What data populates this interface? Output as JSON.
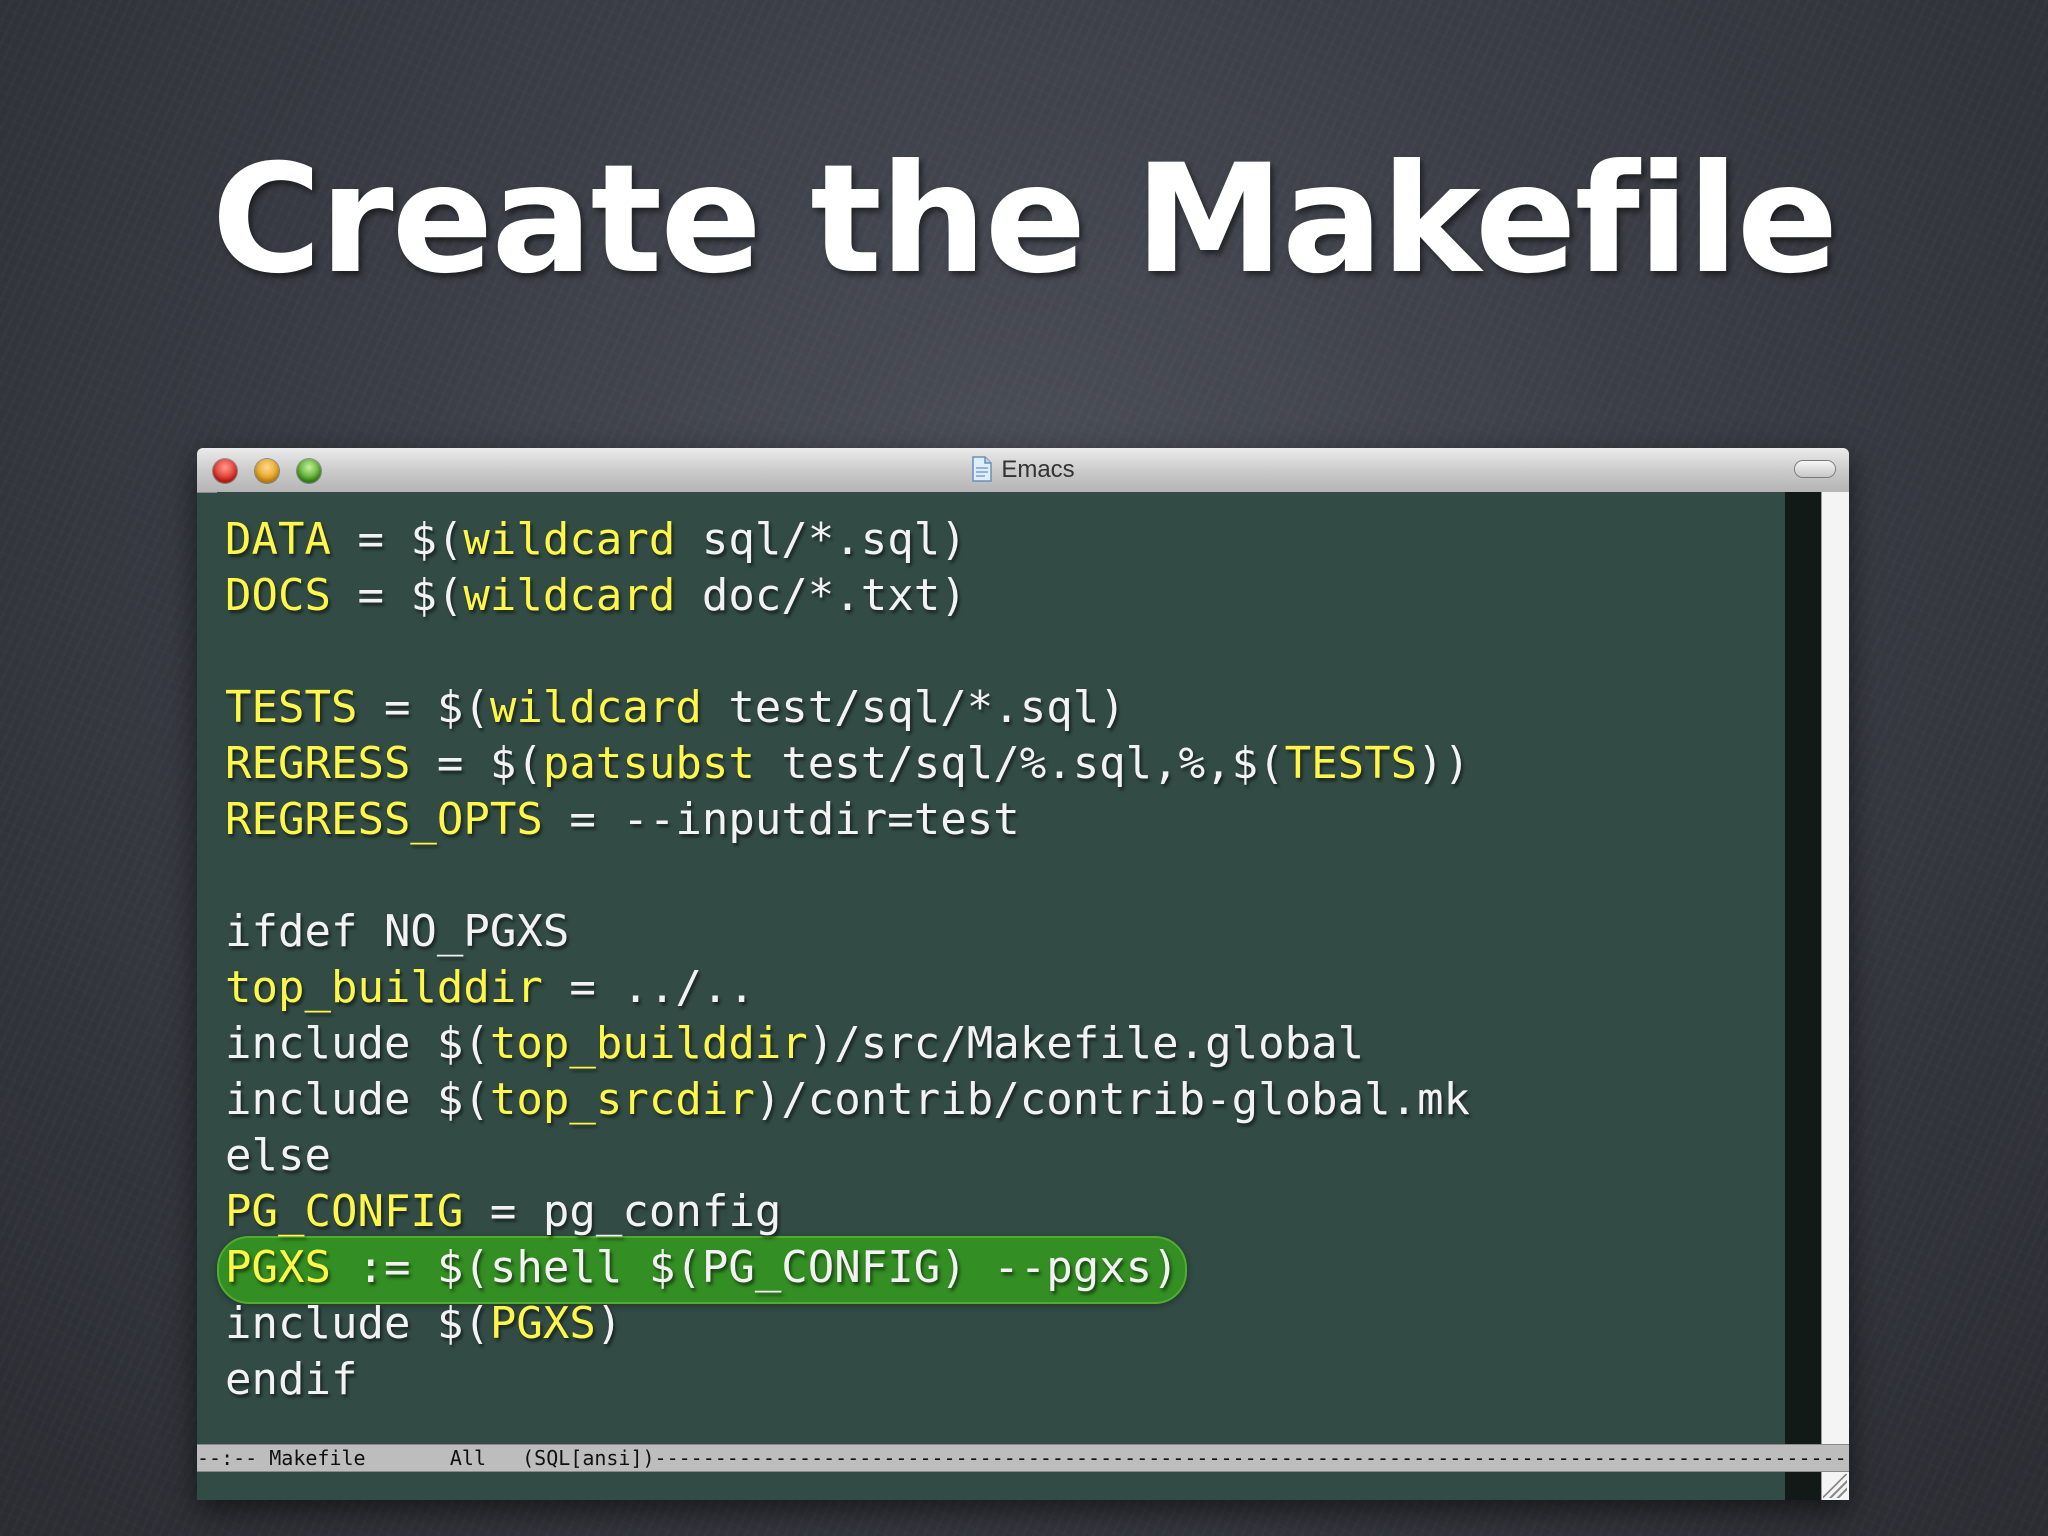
{
  "slide": {
    "title": "Create the Makefile"
  },
  "window": {
    "title": "Emacs",
    "title_icon": "document-icon"
  },
  "editor": {
    "lines": [
      [
        {
          "t": "DATA",
          "c": "kw"
        },
        {
          "t": " = $(",
          "c": "n"
        },
        {
          "t": "wildcard",
          "c": "kw"
        },
        {
          "t": " sql/*.sql)",
          "c": "n"
        }
      ],
      [
        {
          "t": "DOCS",
          "c": "kw"
        },
        {
          "t": " = $(",
          "c": "n"
        },
        {
          "t": "wildcard",
          "c": "kw"
        },
        {
          "t": " doc/*.txt)",
          "c": "n"
        }
      ],
      [],
      [
        {
          "t": "TESTS",
          "c": "kw"
        },
        {
          "t": " = $(",
          "c": "n"
        },
        {
          "t": "wildcard",
          "c": "kw"
        },
        {
          "t": " test/sql/*.sql)",
          "c": "n"
        }
      ],
      [
        {
          "t": "REGRESS",
          "c": "kw"
        },
        {
          "t": " = $(",
          "c": "n"
        },
        {
          "t": "patsubst",
          "c": "kw"
        },
        {
          "t": " test/sql/%.sql,%,$(",
          "c": "n"
        },
        {
          "t": "TESTS",
          "c": "kw"
        },
        {
          "t": "))",
          "c": "n"
        }
      ],
      [
        {
          "t": "REGRESS_OPTS",
          "c": "kw"
        },
        {
          "t": " = --inputdir=test",
          "c": "n"
        }
      ],
      [],
      [
        {
          "t": "ifdef NO_PGXS",
          "c": "n"
        }
      ],
      [
        {
          "t": "top_builddir",
          "c": "kw"
        },
        {
          "t": " = ../..",
          "c": "n"
        }
      ],
      [
        {
          "t": "include $(",
          "c": "n"
        },
        {
          "t": "top_builddir",
          "c": "kw"
        },
        {
          "t": ")/src/Makefile.global",
          "c": "n"
        }
      ],
      [
        {
          "t": "include $(",
          "c": "n"
        },
        {
          "t": "top_srcdir",
          "c": "kw"
        },
        {
          "t": ")/contrib/contrib-global.mk",
          "c": "n"
        }
      ],
      [
        {
          "t": "else",
          "c": "n"
        }
      ],
      [
        {
          "t": "PG_CONFIG",
          "c": "kw"
        },
        {
          "t": " = pg_config",
          "c": "n"
        }
      ],
      [
        {
          "t": "PGXS",
          "c": "kw"
        },
        {
          "t": " := $(shell $(PG_CONFIG) --pgxs)",
          "c": "n"
        }
      ],
      [
        {
          "t": "include $(",
          "c": "n"
        },
        {
          "t": "PGXS",
          "c": "kw"
        },
        {
          "t": ")",
          "c": "n"
        }
      ],
      [
        {
          "t": "endif",
          "c": "n"
        }
      ]
    ],
    "highlighted_line": "PGXS := $(shell $(PG_CONFIG) --pgxs)"
  },
  "modeline": {
    "text": "--:-- Makefile       All   (SQL[ansi])---------------------------------------------------------------------------------------------------------------------------------"
  },
  "colors": {
    "keyword": "#fff64a",
    "text": "#f2f2f2",
    "editor_bg": "#324c45",
    "highlight": "#349620"
  }
}
